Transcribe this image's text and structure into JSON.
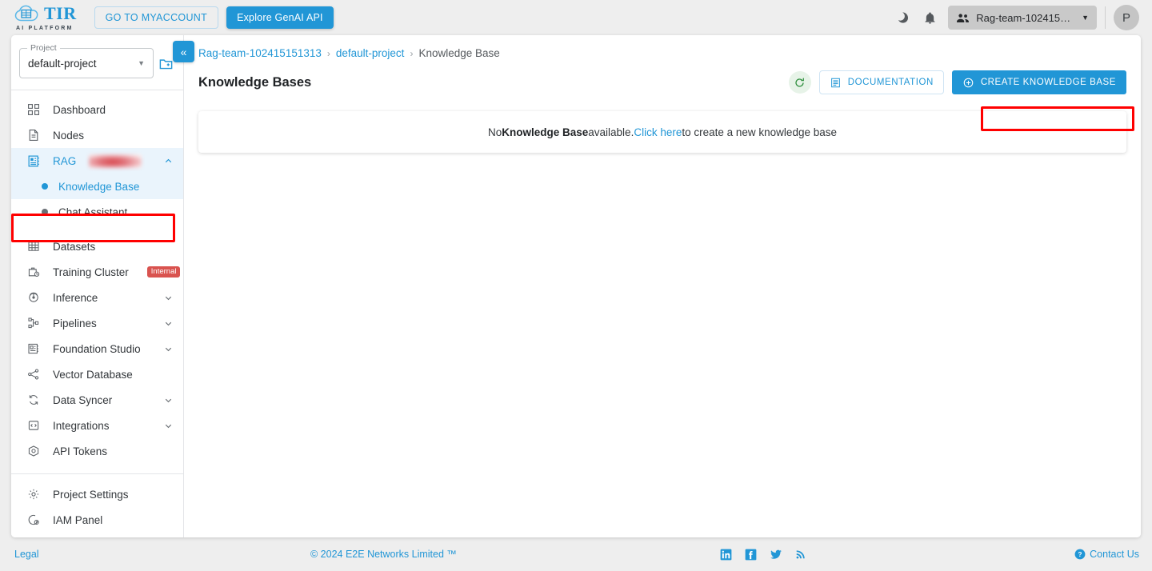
{
  "topbar": {
    "logo_text": "TIR",
    "logo_subtitle": "AI PLATFORM",
    "myaccount_label": "GO TO MYACCOUNT",
    "genai_label": "Explore GenAI API",
    "dark_mode_icon": "moon-icon",
    "notifications_icon": "bell-icon",
    "team_name": "Rag-team-102415…",
    "team_icon": "people-icon",
    "avatar_initial": "P"
  },
  "sidebar": {
    "project_label": "Project",
    "project_value": "default-project",
    "new_project_icon": "new-folder-icon",
    "items": [
      {
        "label": "Dashboard",
        "icon": "dashboard-icon",
        "expandable": false
      },
      {
        "label": "Nodes",
        "icon": "document-icon",
        "expandable": false
      },
      {
        "label": "RAG",
        "icon": "rag-icon",
        "expandable": true,
        "expanded": true,
        "redacted": true
      },
      {
        "label": "Datasets",
        "icon": "datasets-grid-icon",
        "expandable": false
      },
      {
        "label": "Training Cluster",
        "icon": "training-cluster-icon",
        "expandable": false,
        "badge": "Internal"
      },
      {
        "label": "Inference",
        "icon": "inference-icon",
        "expandable": true
      },
      {
        "label": "Pipelines",
        "icon": "pipelines-icon",
        "expandable": true
      },
      {
        "label": "Foundation Studio",
        "icon": "foundation-studio-icon",
        "expandable": true
      },
      {
        "label": "Vector Database",
        "icon": "vector-database-icon",
        "expandable": false
      },
      {
        "label": "Data Syncer",
        "icon": "data-syncer-icon",
        "expandable": true
      },
      {
        "label": "Integrations",
        "icon": "integrations-icon",
        "expandable": true
      },
      {
        "label": "API Tokens",
        "icon": "api-tokens-icon",
        "expandable": false
      }
    ],
    "rag_children": [
      {
        "label": "Knowledge Base",
        "selected": true
      },
      {
        "label": "Chat Assistant",
        "selected": false
      }
    ],
    "bottom_items": [
      {
        "label": "Project Settings",
        "icon": "gear-icon"
      },
      {
        "label": "IAM Panel",
        "icon": "iam-panel-icon"
      }
    ]
  },
  "main": {
    "collapse_icon": "double-chevron-left-icon",
    "breadcrumb": {
      "team": "Rag-team-102415151313",
      "project": "default-project",
      "current": "Knowledge Base",
      "separator": "›"
    },
    "page_title": "Knowledge Bases",
    "refresh_icon": "refresh-icon",
    "documentation_label": "DOCUMENTATION",
    "documentation_icon": "book-icon",
    "create_label": "CREATE KNOWLEDGE BASE",
    "create_icon": "plus-circle-icon",
    "empty_state": {
      "prefix": "No ",
      "bold": "Knowledge Base",
      "middle": " available. ",
      "link": "Click here",
      "suffix": " to create a new knowledge base"
    }
  },
  "footer": {
    "legal": "Legal",
    "copyright": "© 2024 E2E Networks Limited ™",
    "social": [
      "linkedin-icon",
      "facebook-icon",
      "twitter-icon",
      "rss-icon"
    ],
    "contact_label": "Contact Us",
    "contact_icon": "help-circle-icon"
  },
  "colors": {
    "accent": "#2196d6",
    "page_bg": "#eeeeee",
    "highlight_red": "#ff0000",
    "badge_red": "#d9534f",
    "refresh_green": "#2f8f3e"
  }
}
